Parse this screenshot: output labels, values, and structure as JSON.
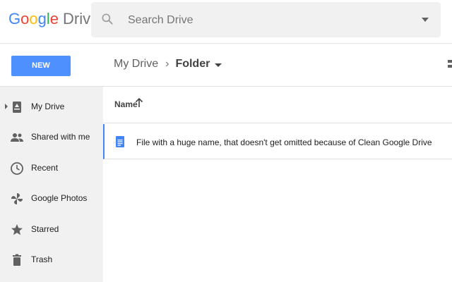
{
  "header": {
    "logo": {
      "letters": [
        "G",
        "o",
        "o",
        "g",
        "l",
        "e"
      ],
      "product": "Drive"
    },
    "search": {
      "placeholder": "Search Drive",
      "value": ""
    }
  },
  "toolbar": {
    "new_label": "NEW",
    "breadcrumb": {
      "root": "My Drive",
      "separator": "›",
      "current": "Folder"
    }
  },
  "sidebar": {
    "items": [
      {
        "label": "My Drive",
        "icon": "my-drive-icon",
        "expandable": true
      },
      {
        "label": "Shared with me",
        "icon": "people-icon"
      },
      {
        "label": "Recent",
        "icon": "clock-icon"
      },
      {
        "label": "Google Photos",
        "icon": "pinwheel-icon"
      },
      {
        "label": "Starred",
        "icon": "star-icon"
      },
      {
        "label": "Trash",
        "icon": "trash-icon"
      }
    ]
  },
  "main": {
    "column_header": "Name",
    "sort": "ascending",
    "files": [
      {
        "name": "File with a huge name, that doesn't get omitted because of Clean Google Drive",
        "icon": "docs-icon"
      }
    ]
  },
  "colors": {
    "accent": "#4285f4",
    "new_button": "#4d90fe",
    "sidebar_bg": "#f1f1f1",
    "search_bg": "#f1f1f1"
  }
}
